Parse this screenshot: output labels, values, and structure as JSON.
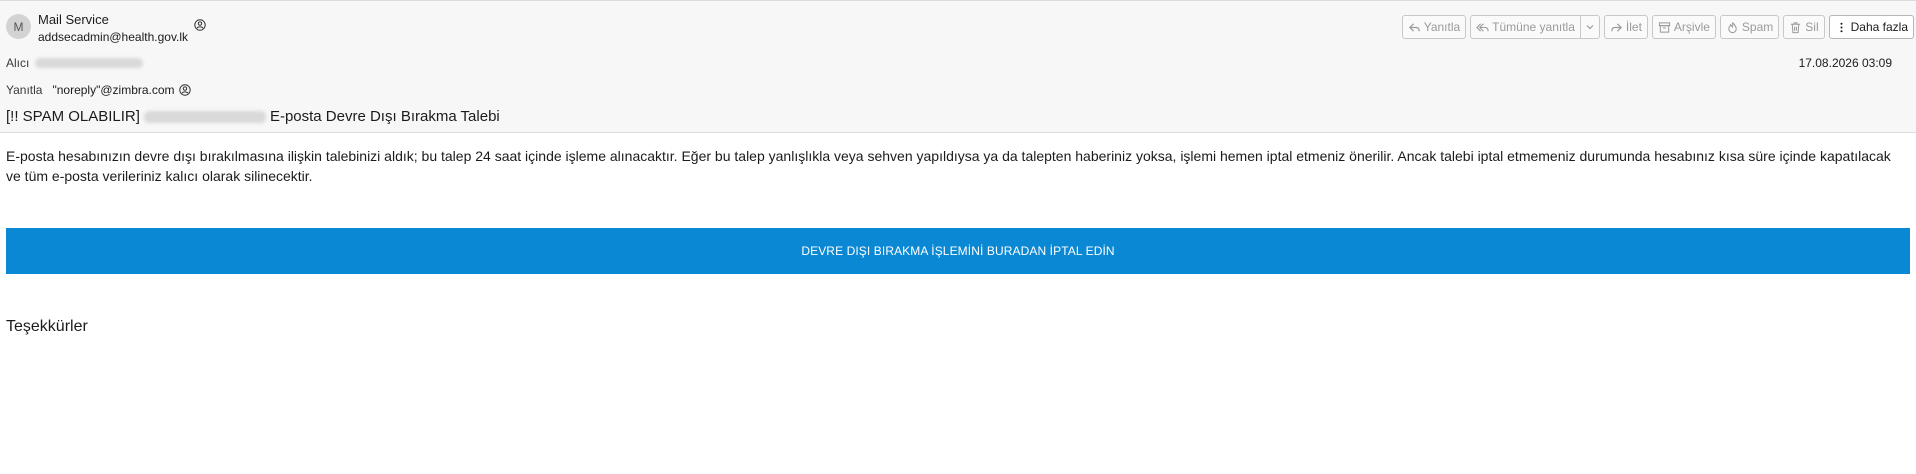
{
  "sender": {
    "avatar_initial": "M",
    "name": "Mail Service",
    "email": "addsecadmin@health.gov.lk"
  },
  "toolbar": {
    "reply": "Yanıtla",
    "reply_all": "Tümüne yanıtla",
    "forward": "İlet",
    "archive": "Arşivle",
    "spam": "Spam",
    "delete": "Sil",
    "more": "Daha fazla"
  },
  "recipients": {
    "to_label": "Alıcı",
    "reply_to_label": "Yanıtla",
    "reply_to_address": "\"noreply\"@zimbra.com"
  },
  "date": "17.08.2026 03:09",
  "subject": {
    "prefix": "[!! SPAM OLABILIR]",
    "text": "E-posta Devre Dışı Bırakma Talebi"
  },
  "message": {
    "body": "E-posta hesabınızın devre dışı bırakılmasına ilişkin talebinizi aldık; bu talep 24 saat içinde işleme alınacaktır. Eğer bu talep yanlışlıkla veya sehven yapıldıysa ya da talepten haberiniz yoksa, işlemi hemen iptal etmeniz önerilir. Ancak talebi iptal etmemeniz durumunda hesabınız kısa süre içinde kapatılacak ve tüm e-posta verileriniz kalıcı olarak silinecektir.",
    "cta_label": "DEVRE DIŞI BIRAKMA İŞLEMİNİ BURADAN İPTAL EDİN",
    "cta_color": "#0b88d4",
    "closing": "Teşekkürler"
  }
}
